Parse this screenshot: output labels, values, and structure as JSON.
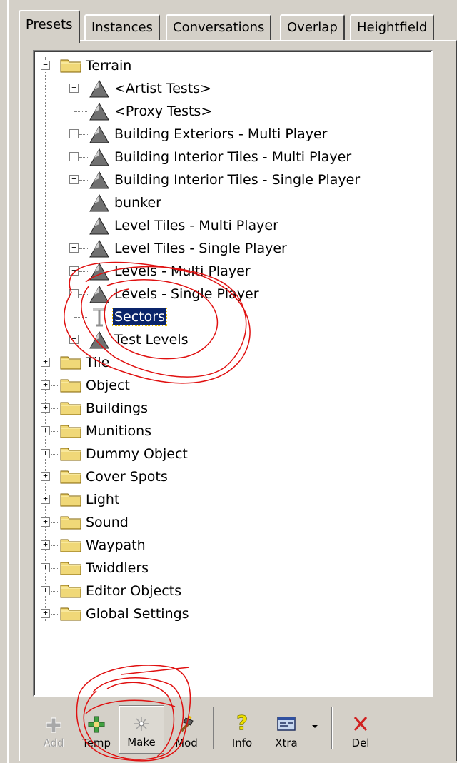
{
  "tabs": [
    {
      "label": "Presets",
      "active": true
    },
    {
      "label": "Instances",
      "active": false
    },
    {
      "label": "Conversations",
      "active": false
    },
    {
      "label": "Overlap",
      "active": false
    },
    {
      "label": "Heightfield",
      "active": false
    }
  ],
  "tree": {
    "root": {
      "label": "Terrain",
      "expanded": true
    },
    "terrain_children": [
      {
        "label": "<Artist Tests>",
        "has_children": true,
        "icon": "terrain-icon"
      },
      {
        "label": "<Proxy Tests>",
        "has_children": false,
        "icon": "terrain-icon"
      },
      {
        "label": "Building Exteriors - Multi Player",
        "has_children": true,
        "icon": "terrain-icon"
      },
      {
        "label": "Building Interior Tiles - Multi Player",
        "has_children": true,
        "icon": "terrain-icon"
      },
      {
        "label": "Building Interior Tiles - Single Player",
        "has_children": true,
        "icon": "terrain-icon"
      },
      {
        "label": "bunker",
        "has_children": false,
        "icon": "terrain-icon"
      },
      {
        "label": "Level Tiles - Multi Player",
        "has_children": false,
        "icon": "terrain-icon"
      },
      {
        "label": "Level Tiles - Single Player",
        "has_children": true,
        "icon": "terrain-icon"
      },
      {
        "label": "Levels - Multi Player",
        "has_children": true,
        "icon": "terrain-icon"
      },
      {
        "label": "Levels - Single Player",
        "has_children": true,
        "icon": "terrain-icon"
      },
      {
        "label": "Sectors",
        "has_children": false,
        "icon": "sector-icon",
        "selected": true
      },
      {
        "label": "Test Levels",
        "has_children": true,
        "icon": "terrain-icon"
      }
    ],
    "top_level": [
      {
        "label": "Tile"
      },
      {
        "label": "Object"
      },
      {
        "label": "Buildings"
      },
      {
        "label": "Munitions"
      },
      {
        "label": "Dummy Object"
      },
      {
        "label": "Cover Spots"
      },
      {
        "label": "Light"
      },
      {
        "label": "Sound"
      },
      {
        "label": "Waypath"
      },
      {
        "label": "Twiddlers"
      },
      {
        "label": "Editor Objects"
      },
      {
        "label": "Global Settings"
      }
    ]
  },
  "toolbar": {
    "add": {
      "label": "Add",
      "icon": "plus-icon",
      "enabled": false
    },
    "temp": {
      "label": "Temp",
      "icon": "temp-icon",
      "enabled": true
    },
    "make": {
      "label": "Make",
      "icon": "make-icon",
      "enabled": true,
      "pressed": true
    },
    "mod": {
      "label": "Mod",
      "icon": "hammer-icon",
      "enabled": true
    },
    "info": {
      "label": "Info",
      "icon": "question-icon",
      "enabled": true
    },
    "xtra": {
      "label": "Xtra",
      "icon": "xtra-icon",
      "enabled": true
    },
    "del": {
      "label": "Del",
      "icon": "x-icon",
      "enabled": true
    }
  },
  "colors": {
    "panel": "#d4d0c8",
    "selection": "#0a246a",
    "annotation": "#e01010",
    "folder": "#f0d878"
  }
}
